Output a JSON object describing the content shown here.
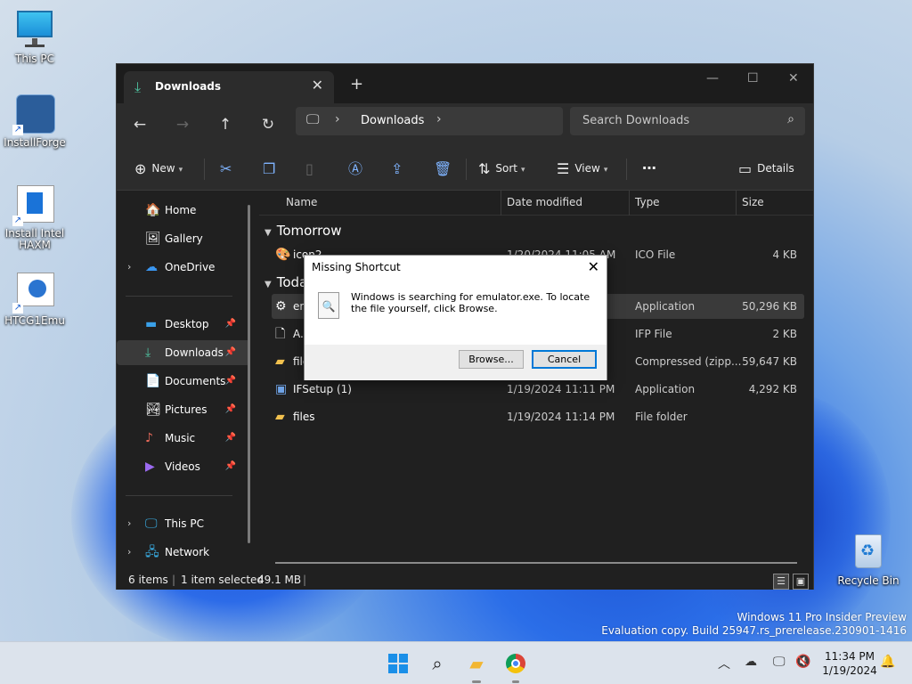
{
  "desktop": {
    "icons": [
      {
        "label": "This PC",
        "icon": "monitor-icon"
      },
      {
        "label": "InstallForge",
        "icon": "installforge-icon"
      },
      {
        "label": "Install Intel HAXM",
        "icon": "installer-icon"
      },
      {
        "label": "HTCG1Emu",
        "icon": "emulator-icon"
      },
      {
        "label": "Recycle Bin",
        "icon": "recycle-bin-icon"
      }
    ],
    "watermark_line1": "Windows 11 Pro Insider Preview",
    "watermark_line2": "Evaluation copy. Build 25947.rs_prerelease.230901-1416"
  },
  "window": {
    "tab_title": "Downloads",
    "address": {
      "crumb": "Downloads"
    },
    "search_placeholder": "Search Downloads",
    "commands": {
      "new": "New",
      "sort": "Sort",
      "view": "View",
      "details": "Details"
    },
    "sidebar": {
      "home": "Home",
      "gallery": "Gallery",
      "onedrive": "OneDrive",
      "desktop": "Desktop",
      "downloads": "Downloads",
      "documents": "Documents",
      "pictures": "Pictures",
      "music": "Music",
      "videos": "Videos",
      "thispc": "This PC",
      "network": "Network"
    },
    "columns": {
      "name": "Name",
      "date": "Date modified",
      "type": "Type",
      "size": "Size"
    },
    "groups": {
      "tomorrow": "Tomorrow",
      "today": "Toda"
    },
    "files": [
      {
        "name": "icon2",
        "date": "1/20/2024 11:05 AM",
        "type": "ICO File",
        "size": "4 KB"
      },
      {
        "name": "em",
        "date": "",
        "type": "Application",
        "size": "50,296 KB"
      },
      {
        "name": "A.i",
        "date": "",
        "type": "IFP File",
        "size": "2 KB"
      },
      {
        "name": "file",
        "date": "",
        "type": "Compressed (zipp...",
        "size": "59,647 KB"
      },
      {
        "name": "IFSetup (1)",
        "date": "1/19/2024 11:11 PM",
        "type": "Application",
        "size": "4,292 KB"
      },
      {
        "name": "files",
        "date": "1/19/2024 11:14 PM",
        "type": "File folder",
        "size": ""
      }
    ],
    "status": {
      "count": "6 items",
      "selected": "1 item selected",
      "size": "49.1 MB"
    }
  },
  "dialog": {
    "title": "Missing Shortcut",
    "message": "Windows is searching for emulator.exe. To locate the file yourself, click Browse.",
    "browse": "Browse...",
    "cancel": "Cancel"
  },
  "taskbar": {
    "time": "11:34 PM",
    "date": "1/19/2024"
  }
}
